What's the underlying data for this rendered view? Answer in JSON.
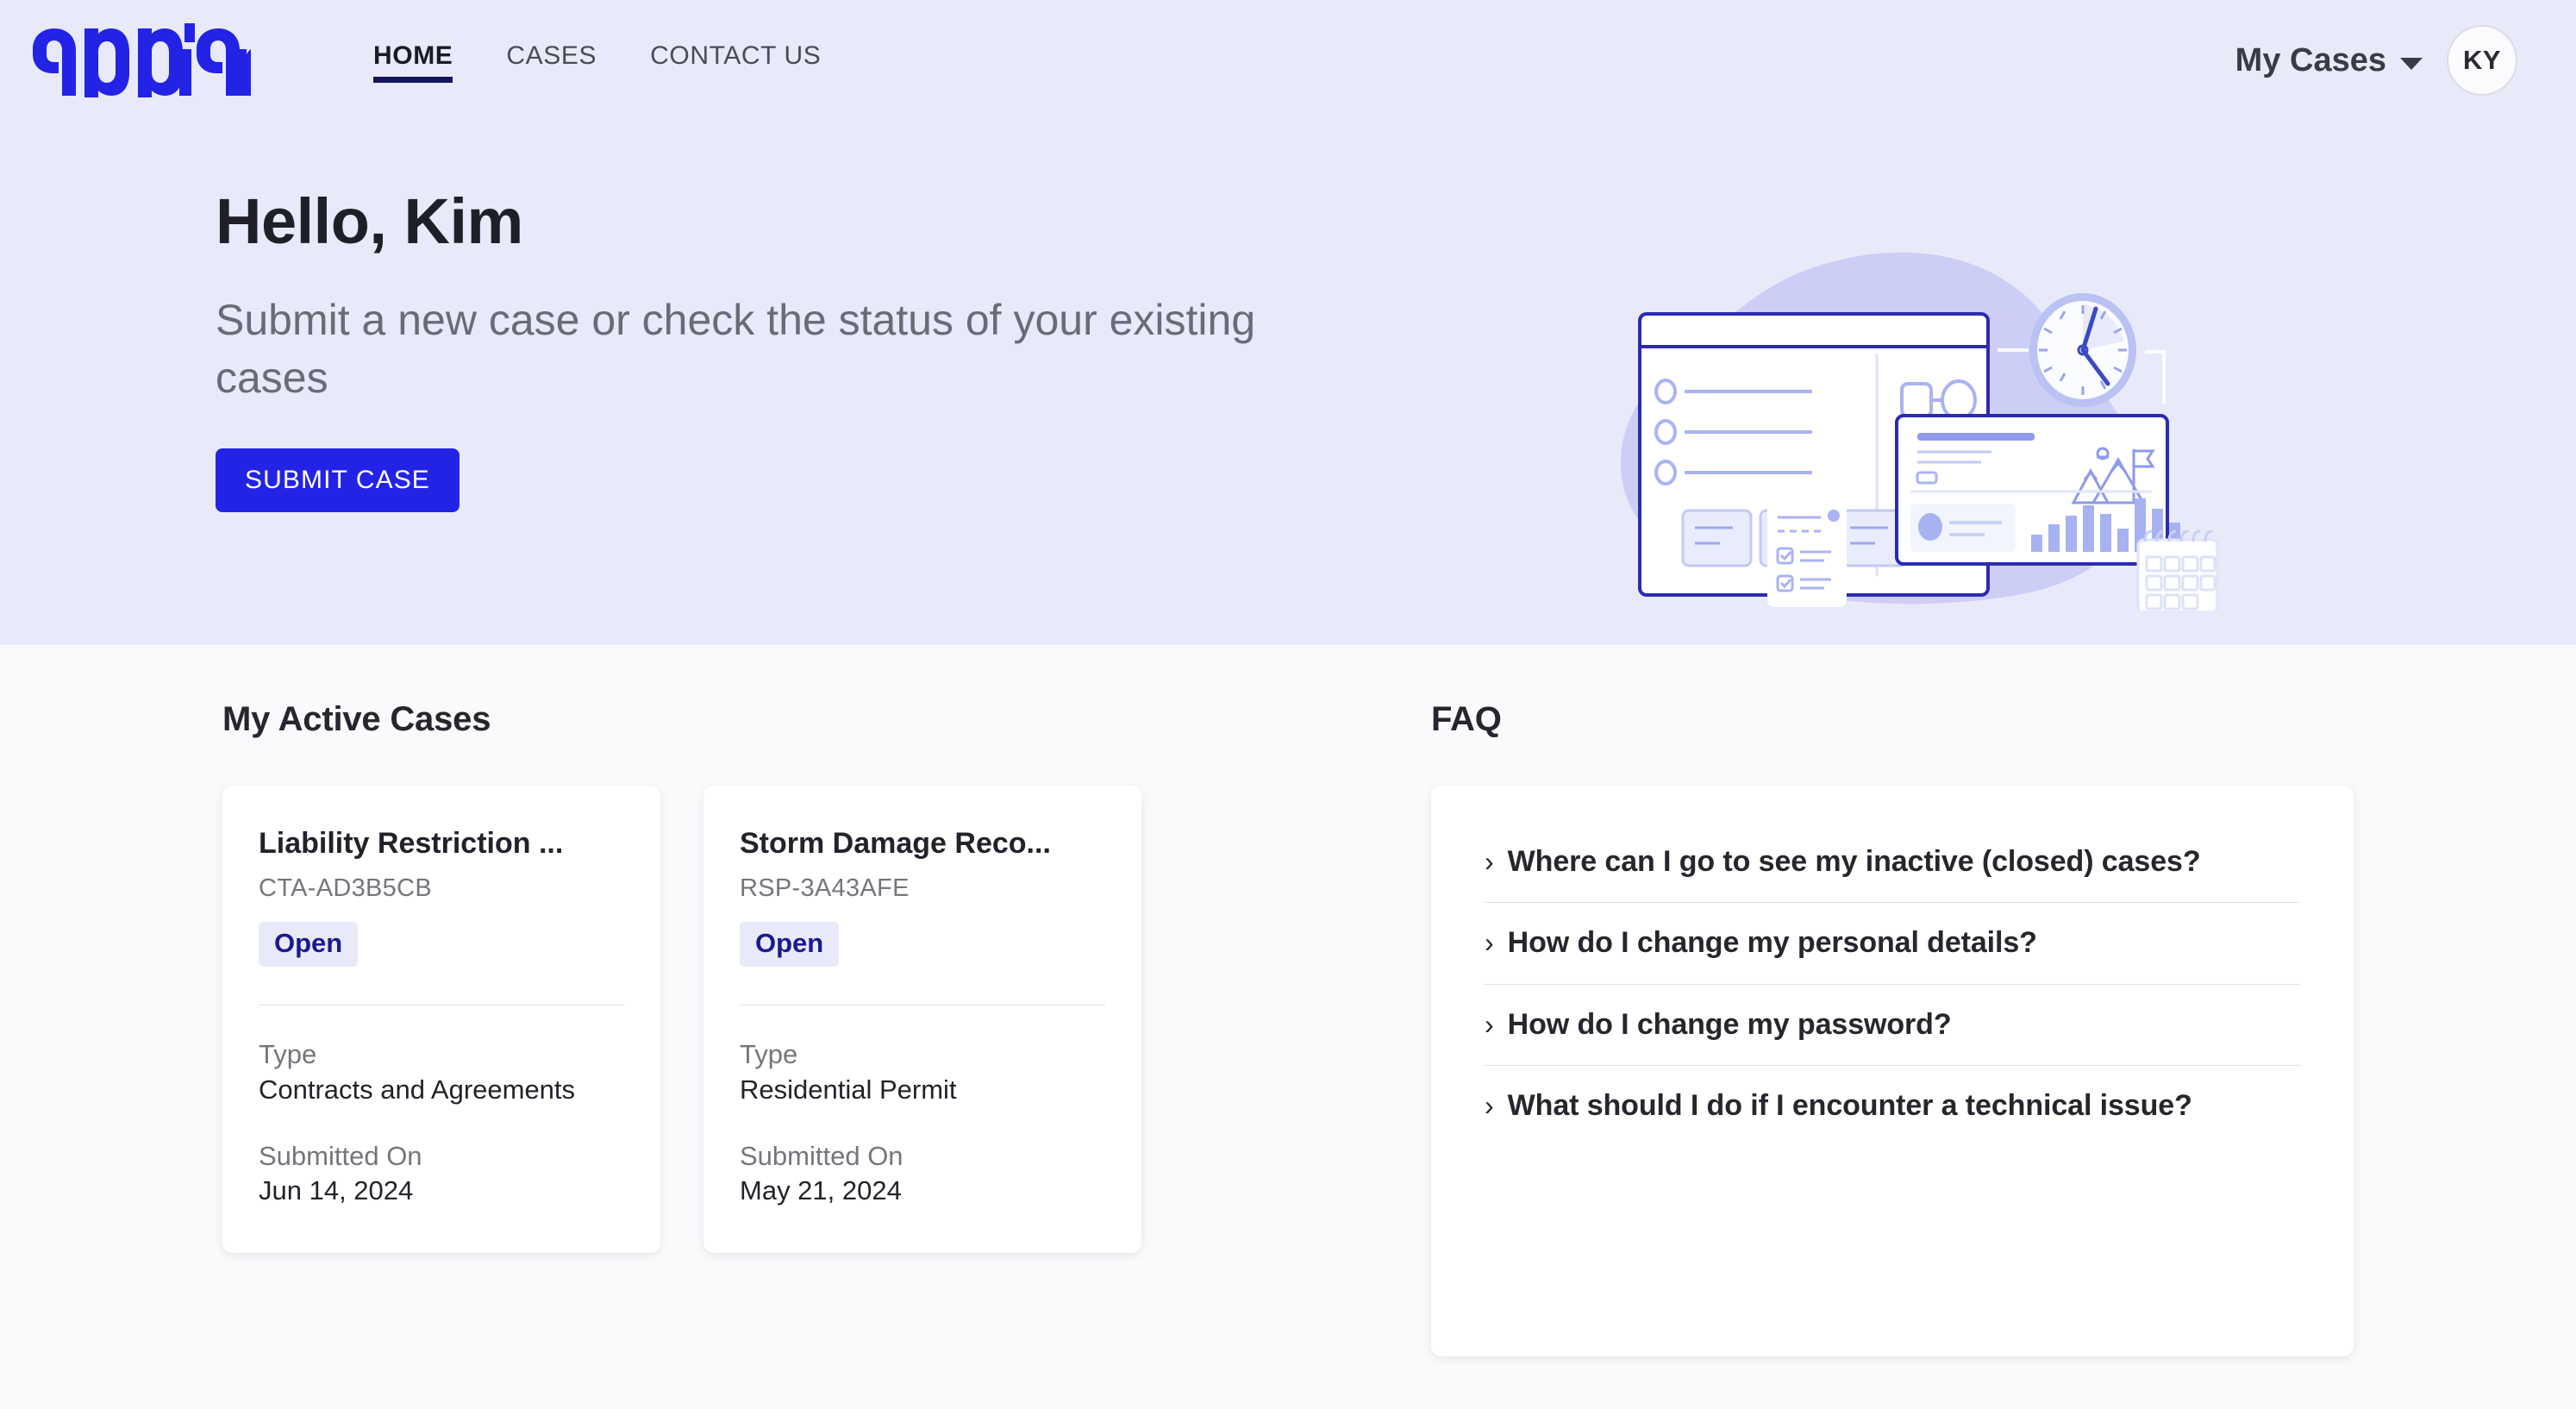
{
  "brand": {
    "logo_text": "appian",
    "logo_color": "#2323e6"
  },
  "header": {
    "nav": [
      {
        "label": "HOME",
        "active": true
      },
      {
        "label": "CASES",
        "active": false
      },
      {
        "label": "CONTACT US",
        "active": false
      }
    ],
    "my_cases_label": "My Cases",
    "avatar_initials": "KY",
    "active_underline_color": "#14145a",
    "background_color": "#e8eafa"
  },
  "hero": {
    "greeting": "Hello, Kim",
    "subtitle": "Submit a new case or check the status of your existing cases",
    "submit_button_label": "SUBMIT CASE",
    "submit_button_color": "#2323e6",
    "illustration": "case-management-illustration"
  },
  "active_cases": {
    "title": "My Active Cases",
    "labels": {
      "type": "Type",
      "submitted_on": "Submitted On"
    },
    "items": [
      {
        "title": "Liability Restriction ...",
        "case_id": "CTA-AD3B5CB",
        "status": "Open",
        "status_bg": "#e8eafa",
        "status_color": "#1a1a8c",
        "type": "Contracts and Agreements",
        "submitted_on": "Jun 14, 2024"
      },
      {
        "title": "Storm Damage Reco...",
        "case_id": "RSP-3A43AFE",
        "status": "Open",
        "status_bg": "#e8eafa",
        "status_color": "#1a1a8c",
        "type": "Residential Permit",
        "submitted_on": "May 21, 2024"
      }
    ]
  },
  "faq": {
    "title": "FAQ",
    "chevron": "›",
    "items": [
      {
        "question": "Where can I go to see my inactive (closed) cases?"
      },
      {
        "question": "How do I change my personal details?"
      },
      {
        "question": "How do I change my password?"
      },
      {
        "question": "What should I do if I encounter a technical issue?"
      }
    ]
  }
}
